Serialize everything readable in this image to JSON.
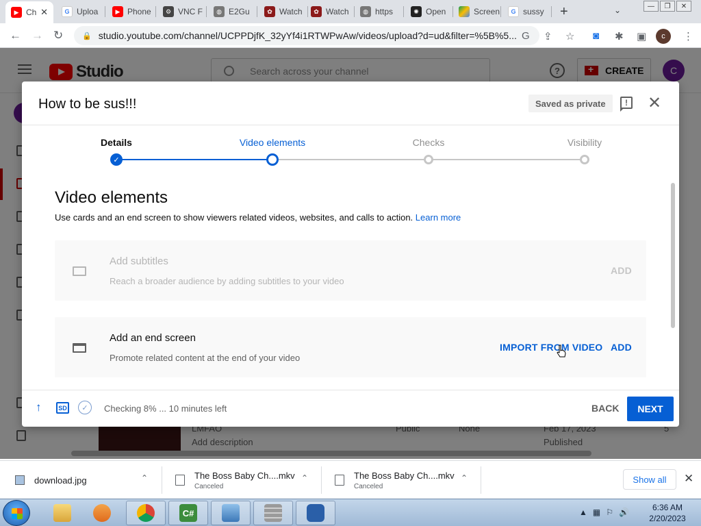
{
  "browser": {
    "tabs": [
      {
        "label": "Ch",
        "icon": "youtube-favicon",
        "close": "✕"
      },
      {
        "label": "Uploa",
        "icon": "google-favicon"
      },
      {
        "label": "Phone",
        "icon": "youtube-favicon"
      },
      {
        "label": "VNC F",
        "icon": "vnc-favicon"
      },
      {
        "label": "E2Gu",
        "icon": "globe-favicon"
      },
      {
        "label": "Watch",
        "icon": "film-favicon"
      },
      {
        "label": "Watch",
        "icon": "film-favicon"
      },
      {
        "label": "https",
        "icon": "globe-favicon"
      },
      {
        "label": "Open",
        "icon": "openai-favicon"
      },
      {
        "label": "Screen",
        "icon": "drive-favicon"
      },
      {
        "label": "sussy",
        "icon": "google-favicon"
      }
    ],
    "new_tab": "+",
    "tab_menu": "⌄",
    "window_controls": {
      "minimize": "—",
      "maximize": "❐",
      "close": "✕"
    },
    "nav": {
      "back": "←",
      "forward": "→",
      "reload": "↻"
    },
    "url": "studio.youtube.com/channel/UCPPDjfK_32yYf4i1RTWPwAw/videos/upload?d=ud&filter=%5B%5...",
    "toolbar_icons": [
      "G",
      "⇪",
      "☆",
      "◙",
      "✱",
      "▣",
      "⋮"
    ],
    "profile_initial": "c"
  },
  "studio": {
    "logo_text": "Studio",
    "search_placeholder": "Search across your channel",
    "help": "?",
    "create_label": "CREATE",
    "avatar_initial": "C",
    "bg_row": {
      "title": "LMFAO",
      "description": "Add description",
      "visibility": "Public",
      "restrictions": "None",
      "date": "Feb 17, 2023",
      "date_status": "Published",
      "views": "5"
    }
  },
  "dialog": {
    "title": "How to be sus!!!",
    "saved_badge": "Saved as private",
    "feedback_icon": "!",
    "close": "✕",
    "steps": [
      {
        "label": "Details",
        "state": "done"
      },
      {
        "label": "Video elements",
        "state": "current"
      },
      {
        "label": "Checks",
        "state": "future"
      },
      {
        "label": "Visibility",
        "state": "future"
      }
    ],
    "section_title": "Video elements",
    "section_desc": "Use cards and an end screen to show viewers related videos, websites, and calls to action.",
    "learn_more": "Learn more",
    "elements": [
      {
        "name": "Add subtitles",
        "desc": "Reach a broader audience by adding subtitles to your video",
        "action": "ADD",
        "disabled": true
      },
      {
        "name": "Add an end screen",
        "desc": "Promote related content at the end of your video",
        "import_action": "IMPORT FROM VIDEO",
        "action": "ADD",
        "disabled": false
      }
    ],
    "footer": {
      "upload_icon": "↑",
      "sd_badge": "SD",
      "check_icon": "✓",
      "status": "Checking 8% ... 10 minutes left",
      "back": "BACK",
      "next": "NEXT"
    }
  },
  "downloads": {
    "items": [
      {
        "name": "download.jpg",
        "status": ""
      },
      {
        "name": "The Boss Baby Ch....mkv",
        "status": "Canceled"
      },
      {
        "name": "The Boss Baby Ch....mkv",
        "status": "Canceled"
      }
    ],
    "chevron": "⌃",
    "show_all": "Show all",
    "close": "✕"
  },
  "taskbar": {
    "apps": [
      "file-explorer",
      "media-player",
      "chrome",
      "csharp-editor",
      "control-panel",
      "firewall",
      "remote-desktop"
    ],
    "tray": [
      "▲",
      "▦",
      "⚐",
      "🔊"
    ],
    "time": "6:36 AM",
    "date": "2/20/2023"
  },
  "colors": {
    "accent": "#065fd4",
    "youtube_red": "#ff0000",
    "avatar": "#6a1b9a"
  }
}
